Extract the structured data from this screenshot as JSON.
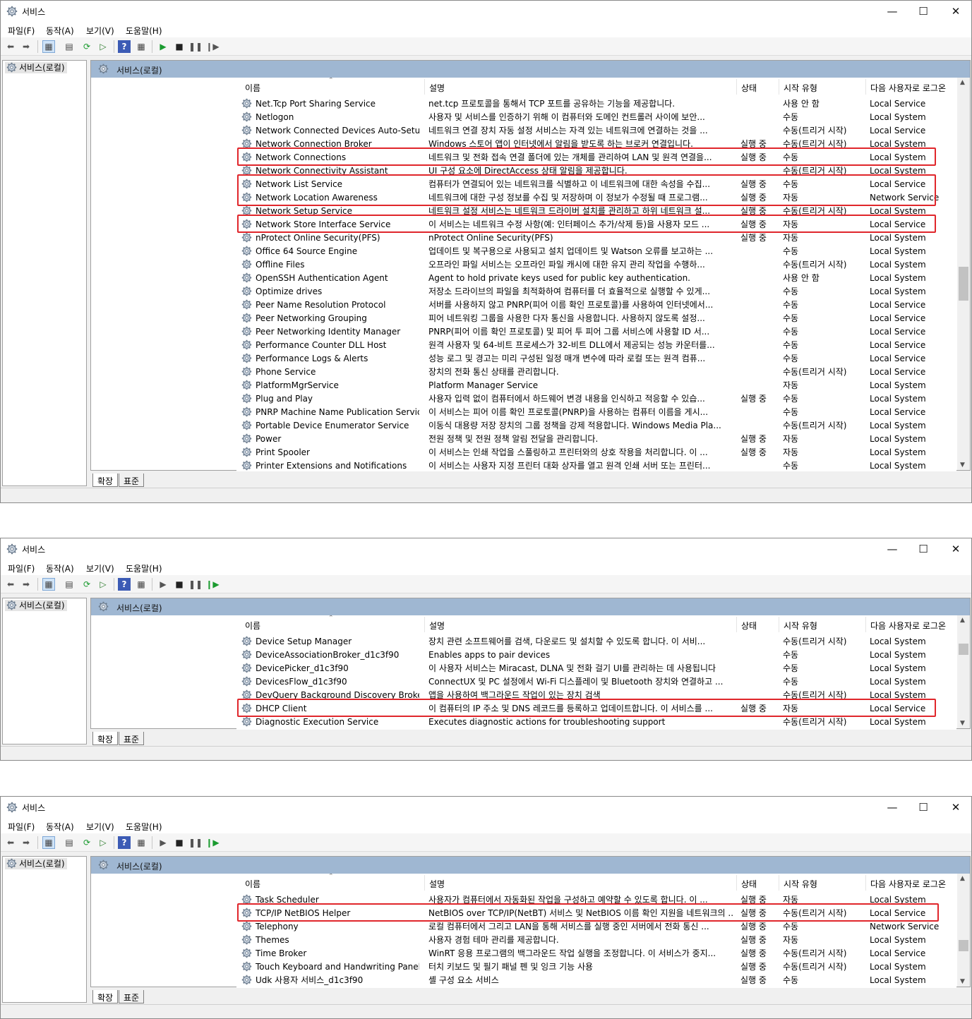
{
  "windows": [
    {
      "title": "서비스",
      "menu": [
        "파일(F)",
        "동작(A)",
        "보기(V)",
        "도움말(H)"
      ],
      "tree_node": "서비스(로컬)",
      "pane_title": "서비스(로컬)",
      "columns": {
        "name": "이름",
        "desc": "설명",
        "status": "상태",
        "start": "시작 유형",
        "logon": "다음 사용자로 로그온"
      },
      "tabs": [
        "확장",
        "표준"
      ],
      "rows": [
        [
          "Net.Tcp Port Sharing Service",
          "net.tcp 프로토콜을 통해서 TCP 포트를 공유하는 기능을 제공합니다.",
          "",
          "사용 안 함",
          "Local Service"
        ],
        [
          "Netlogon",
          "사용자 및 서비스를 인증하기 위해 이 컴퓨터와 도메인 컨트롤러 사이에 보안...",
          "",
          "수동",
          "Local System"
        ],
        [
          "Network Connected Devices Auto-Setup",
          "네트워크 연결 장치 자동 설정 서비스는 자격 있는 네트워크에 연결하는 것을 ...",
          "",
          "수동(트리거 시작)",
          "Local Service"
        ],
        [
          "Network Connection Broker",
          "Windows 스토어 앱이 인터넷에서 알림을 받도록 하는 브로커 연결입니다.",
          "실행 중",
          "수동(트리거 시작)",
          "Local System"
        ],
        [
          "Network Connections",
          "네트워크 및 전화 접속 연결 폴더에 있는 개체를 관리하여 LAN 및 원격 연결을...",
          "실행 중",
          "수동",
          "Local System"
        ],
        [
          "Network Connectivity Assistant",
          "UI 구성 요소에 DirectAccess 상태 알림을 제공합니다.",
          "",
          "수동(트리거 시작)",
          "Local System"
        ],
        [
          "Network List Service",
          "컴퓨터가 연결되어 있는 네트워크를 식별하고 이 네트워크에 대한 속성을 수집...",
          "실행 중",
          "수동",
          "Local Service"
        ],
        [
          "Network Location Awareness",
          "네트워크에 대한 구성 정보를 수집 및 저장하며 이 정보가 수정될 때 프로그램...",
          "실행 중",
          "자동",
          "Network Service"
        ],
        [
          "Network Setup Service",
          "네트워크 설정 서비스는 네트워크 드라이버 설치를 관리하고 하위 네트워크 설...",
          "실행 중",
          "수동(트리거 시작)",
          "Local System"
        ],
        [
          "Network Store Interface Service",
          "이 서비스는 네트워크 수정 사항(예: 인터페이스 추가/삭제 등)을 사용자 모드 ...",
          "실행 중",
          "자동",
          "Local Service"
        ],
        [
          "nProtect Online Security(PFS)",
          "nProtect Online Security(PFS)",
          "실행 중",
          "자동",
          "Local System"
        ],
        [
          "Office 64 Source Engine",
          "업데이트 및 복구용으로 사용되고 설치 업데이트 및 Watson 오류를 보고하는 ...",
          "",
          "수동",
          "Local System"
        ],
        [
          "Offline Files",
          "오프라인 파일 서비스는 오프라인 파일 캐시에 대한 유지 관리 작업을 수행하...",
          "",
          "수동(트리거 시작)",
          "Local System"
        ],
        [
          "OpenSSH Authentication Agent",
          "Agent to hold private keys used for public key authentication.",
          "",
          "사용 안 함",
          "Local System"
        ],
        [
          "Optimize drives",
          "저장소 드라이브의 파일을 최적화하여 컴퓨터를 더 효율적으로 실행할 수 있게...",
          "",
          "수동",
          "Local System"
        ],
        [
          "Peer Name Resolution Protocol",
          "서버를 사용하지 않고 PNRP(피어 이름 확인 프로토콜)를 사용하여 인터넷에서...",
          "",
          "수동",
          "Local Service"
        ],
        [
          "Peer Networking Grouping",
          "피어 네트워킹 그룹을 사용한 다자 통신을 사용합니다. 사용하지 않도록 설정...",
          "",
          "수동",
          "Local Service"
        ],
        [
          "Peer Networking Identity Manager",
          "PNRP(피어 이름 확인 프로토콜) 및 피어 투 피어 그룹 서비스에 사용할 ID 서...",
          "",
          "수동",
          "Local Service"
        ],
        [
          "Performance Counter DLL Host",
          "원격 사용자 및 64-비트 프로세스가 32-비트 DLL에서 제공되는 성능 카운터를...",
          "",
          "수동",
          "Local Service"
        ],
        [
          "Performance Logs & Alerts",
          "성능 로그 및 경고는 미리 구성된 일정 매개 변수에 따라 로컬 또는 원격 컴퓨...",
          "",
          "수동",
          "Local Service"
        ],
        [
          "Phone Service",
          "장치의 전화 통신 상태를 관리합니다.",
          "",
          "수동(트리거 시작)",
          "Local Service"
        ],
        [
          "PlatformMgrService",
          "Platform Manager Service",
          "",
          "자동",
          "Local System"
        ],
        [
          "Plug and Play",
          "사용자 입력 없이 컴퓨터에서 하드웨어 변경 내용을 인식하고 적응할 수 있습...",
          "실행 중",
          "수동",
          "Local System"
        ],
        [
          "PNRP Machine Name Publication Service",
          "이 서비스는 피어 이름 확인 프로토콜(PNRP)을 사용하는 컴퓨터 이름을 게시...",
          "",
          "수동",
          "Local Service"
        ],
        [
          "Portable Device Enumerator Service",
          "이동식 대용량 저장 장치의 그룹 정책을 강제 적용합니다. Windows Media Pla...",
          "",
          "수동(트리거 시작)",
          "Local System"
        ],
        [
          "Power",
          "전원 정책 및 전원 정책 알림 전달을 관리합니다.",
          "실행 중",
          "자동",
          "Local System"
        ],
        [
          "Print Spooler",
          "이 서비스는 인쇄 작업을 스풀링하고 프린터와의 상호 작용을 처리합니다. 이 ...",
          "실행 중",
          "자동",
          "Local System"
        ],
        [
          "Printer Extensions and Notifications",
          "이 서비스는 사용자 지정 프린터 대화 상자를 열고 원격 인쇄 서버 또는 프린터...",
          "",
          "수동",
          "Local System"
        ]
      ]
    },
    {
      "title": "서비스",
      "menu": [
        "파일(F)",
        "동작(A)",
        "보기(V)",
        "도움말(H)"
      ],
      "tree_node": "서비스(로컬)",
      "pane_title": "서비스(로컬)",
      "columns": {
        "name": "이름",
        "desc": "설명",
        "status": "상태",
        "start": "시작 유형",
        "logon": "다음 사용자로 로그온"
      },
      "tabs": [
        "확장",
        "표준"
      ],
      "rows": [
        [
          "Device Setup Manager",
          "장치 관련 소프트웨어를 검색, 다운로드 및 설치할 수 있도록 합니다. 이 서비...",
          "",
          "수동(트리거 시작)",
          "Local System"
        ],
        [
          "DeviceAssociationBroker_d1c3f90",
          "Enables apps to pair devices",
          "",
          "수동",
          "Local System"
        ],
        [
          "DevicePicker_d1c3f90",
          "이 사용자 서비스는 Miracast, DLNA 및 전화 걸기 UI를 관리하는 데 사용됩니다",
          "",
          "수동",
          "Local System"
        ],
        [
          "DevicesFlow_d1c3f90",
          "ConnectUX 및 PC 설정에서 Wi-Fi 디스플레이 및 Bluetooth 장치와 연결하고 ...",
          "",
          "수동",
          "Local System"
        ],
        [
          "DevQuery Background Discovery Broker",
          "앱을 사용하여 백그라운드 작업이 있는 장치 검색",
          "",
          "수동(트리거 시작)",
          "Local System"
        ],
        [
          "DHCP Client",
          "이 컴퓨터의 IP 주소 및 DNS 레코드를 등록하고 업데이트합니다. 이 서비스를 ...",
          "실행 중",
          "자동",
          "Local Service"
        ],
        [
          "Diagnostic Execution Service",
          "Executes diagnostic actions for troubleshooting support",
          "",
          "수동(트리거 시작)",
          "Local System"
        ]
      ]
    },
    {
      "title": "서비스",
      "menu": [
        "파일(F)",
        "동작(A)",
        "보기(V)",
        "도움말(H)"
      ],
      "tree_node": "서비스(로컬)",
      "pane_title": "서비스(로컬)",
      "columns": {
        "name": "이름",
        "desc": "설명",
        "status": "상태",
        "start": "시작 유형",
        "logon": "다음 사용자로 로그온"
      },
      "tabs": [
        "확장",
        "표준"
      ],
      "rows": [
        [
          "Task Scheduler",
          "사용자가 컴퓨터에서 자동화된 작업을 구성하고 예약할 수 있도록 합니다. 이 ...",
          "실행 중",
          "자동",
          "Local System"
        ],
        [
          "TCP/IP NetBIOS Helper",
          "NetBIOS over TCP/IP(NetBT) 서비스 및 NetBIOS 이름 확인 지원을 네트워크의 ...",
          "실행 중",
          "수동(트리거 시작)",
          "Local Service"
        ],
        [
          "Telephony",
          "로컬 컴퓨터에서 그리고 LAN을 통해 서비스를 실행 중인 서버에서 전화 통신 ...",
          "실행 중",
          "수동",
          "Network Service"
        ],
        [
          "Themes",
          "사용자 경험 테마 관리를 제공합니다.",
          "실행 중",
          "자동",
          "Local System"
        ],
        [
          "Time Broker",
          "WinRT 응용 프로그램의 백그라운드 작업 실행을 조정합니다. 이 서비스가 중지...",
          "실행 중",
          "수동(트리거 시작)",
          "Local Service"
        ],
        [
          "Touch Keyboard and Handwriting Panel S...",
          "터치 키보드 및 필기 패널 펜 및 잉크 기능 사용",
          "실행 중",
          "수동(트리거 시작)",
          "Local System"
        ],
        [
          "Udk 사용자 서비스_d1c3f90",
          "셸 구성 요소 서비스",
          "실행 중",
          "수동",
          "Local System"
        ]
      ]
    }
  ],
  "icons": {
    "app": "services-gear-icon",
    "back": "back-arrow-icon",
    "forward": "forward-arrow-icon",
    "play": "play-icon",
    "stop": "stop-icon",
    "pause": "pause-icon",
    "resume": "resume-icon",
    "help": "help-icon"
  },
  "colors": {
    "highlight": "#e0262b",
    "pane_header": "#9fb7d2",
    "play_green": "#1a9b2f"
  }
}
